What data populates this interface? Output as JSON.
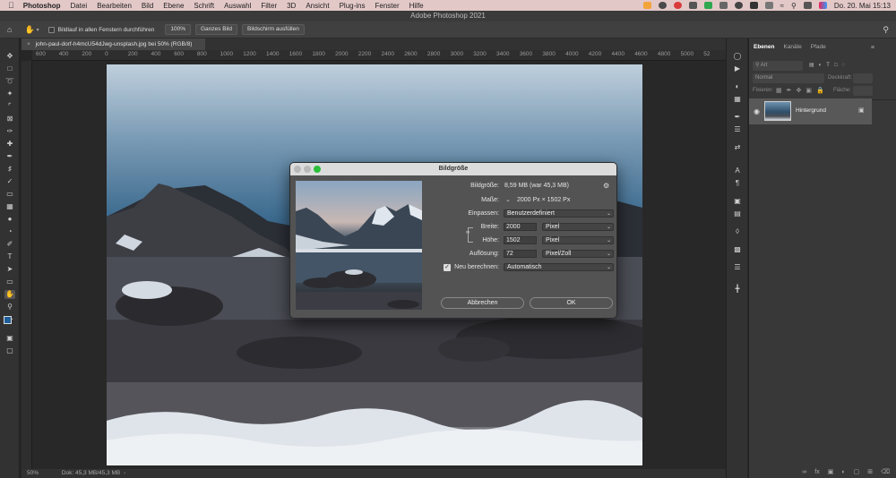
{
  "menubar": {
    "app": "Photoshop",
    "items": [
      "Datei",
      "Bearbeiten",
      "Bild",
      "Ebene",
      "Schrift",
      "Auswahl",
      "Filter",
      "3D",
      "Ansicht",
      "Plug-ins",
      "Fenster",
      "Hilfe"
    ],
    "clock": "Do. 20. Mai  15:13"
  },
  "window": {
    "title": "Adobe Photoshop 2021"
  },
  "options": {
    "scroll_all_label": "Bildlauf in allen Fenstern durchführen",
    "zoom_100": "100%",
    "fit_screen": "Ganzes Bild",
    "fill_screen": "Bildschirm ausfüllen"
  },
  "document": {
    "tab": "john-paul-dorf-h4mcU54dJwg-unsplash.jpg bei 50% (RGB/8)"
  },
  "ruler": {
    "ticks": [
      "600",
      "400",
      "200",
      "0",
      "200",
      "400",
      "600",
      "800",
      "1000",
      "1200",
      "1400",
      "1600",
      "1800",
      "2000",
      "2200",
      "2400",
      "2600",
      "2800",
      "3000",
      "3200",
      "3400",
      "3600",
      "3800",
      "4000",
      "4200",
      "4400",
      "4600",
      "4800",
      "5000",
      "52"
    ]
  },
  "status": {
    "zoom": "50%",
    "doc_info": "Dok: 45,3 MB/45,3 MB"
  },
  "panel": {
    "tabs": [
      "Ebenen",
      "Kanäle",
      "Pfade"
    ],
    "filter_label": "Art",
    "blend_mode": "Normal",
    "opacity_label": "Deckkraft:",
    "lock_label": "Fixieren:",
    "fill_label": "Fläche:",
    "layer_name": "Hintergrund"
  },
  "dialog": {
    "title": "Bildgröße",
    "image_size_label": "Bildgröße:",
    "image_size_value": "8,59 MB (war 45,3 MB)",
    "dimensions_label": "Maße:",
    "dimensions_value": "2000 Px  ×  1502 Px",
    "fit_label": "Einpassen:",
    "fit_value": "Benutzerdefiniert",
    "width_label": "Breite:",
    "width_value": "2000",
    "width_unit": "Pixel",
    "height_label": "Höhe:",
    "height_value": "1502",
    "height_unit": "Pixel",
    "resolution_label": "Auflösung:",
    "resolution_value": "72",
    "resolution_unit": "Pixel/Zoll",
    "resample_label": "Neu berechnen:",
    "resample_value": "Automatisch",
    "cancel": "Abbrechen",
    "ok": "OK"
  }
}
